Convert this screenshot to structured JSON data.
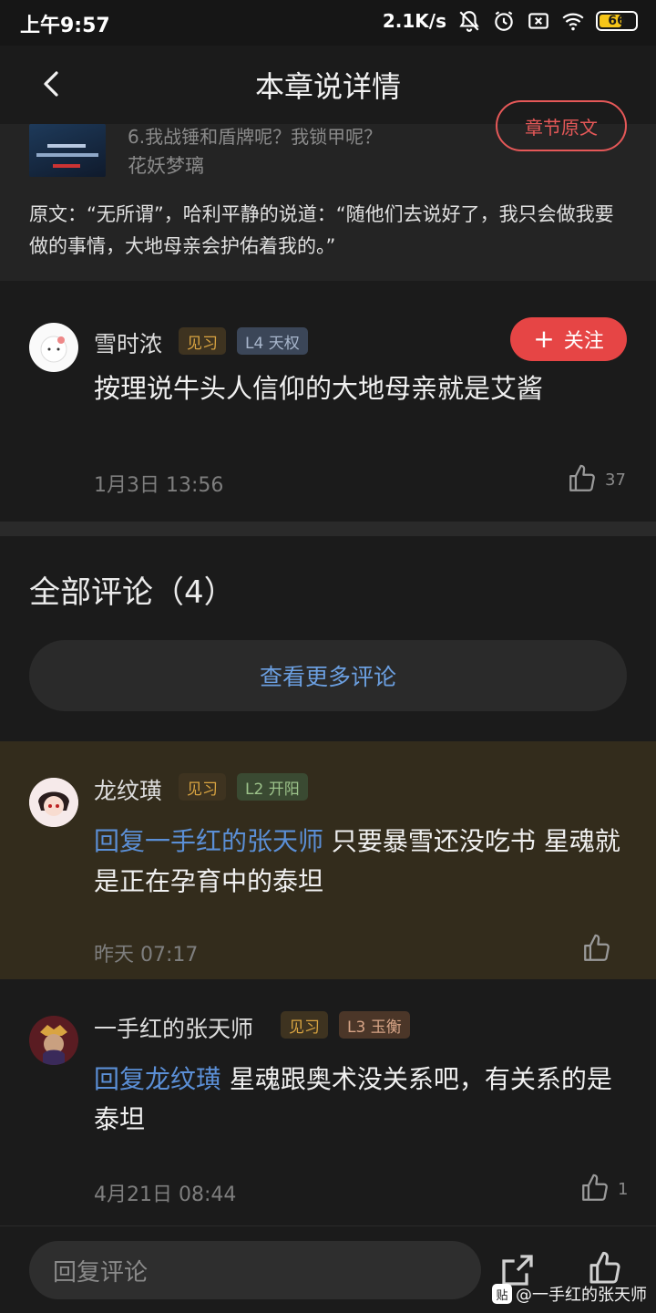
{
  "status": {
    "time": "上午9:57",
    "speed": "2.1K/s",
    "battery": "66",
    "battery_level": 0.66,
    "icons": [
      "bell-off-icon",
      "alarm-icon",
      "sim-off-icon",
      "wifi-icon",
      "battery-icon"
    ]
  },
  "header": {
    "title": "本章说详情",
    "back_icon": "chevron-left-icon"
  },
  "source": {
    "chapter": "6.我战锤和盾牌呢？我锁甲呢？",
    "author": "花妖梦璃",
    "origin_button": "章节原文",
    "text": "原文：“无所谓”，哈利平静的说道：“随他们去说好了，我只会做我要做的事情，大地母亲会护佑着我的。”"
  },
  "main_comment": {
    "username": "雪时浓",
    "badge_role": "见习",
    "badge_level": "L4 天权",
    "follow_label": "关注",
    "text": "按理说牛头人信仰的大地母亲就是艾酱",
    "time": "1月3日 13:56",
    "likes": "37"
  },
  "all_comments": {
    "title": "全部评论（4）",
    "more_label": "查看更多评论"
  },
  "comments": [
    {
      "username": "龙纹璜",
      "badge_role": "见习",
      "badge_level": "L2 开阳",
      "reply_to": "回复一手红的张天师",
      "text": "只要暴雪还没吃书 星魂就是正在孕育中的泰坦",
      "time": "昨天 07:17",
      "likes": ""
    },
    {
      "username": "一手红的张天师",
      "badge_role": "见习",
      "badge_level": "L3 玉衡",
      "reply_to": "回复龙纹璜",
      "text": "星魂跟奥术没关系吧，有关系的是泰坦",
      "time": "4月21日 08:44",
      "likes": "1"
    }
  ],
  "bottom": {
    "placeholder": "回复评论",
    "watermark": "@一手红的张天师",
    "watermark_icon": "贴"
  },
  "colors": {
    "accent_red": "#e64545",
    "link_blue": "#5b8fd6",
    "highlight_bg": "#332c1c"
  }
}
